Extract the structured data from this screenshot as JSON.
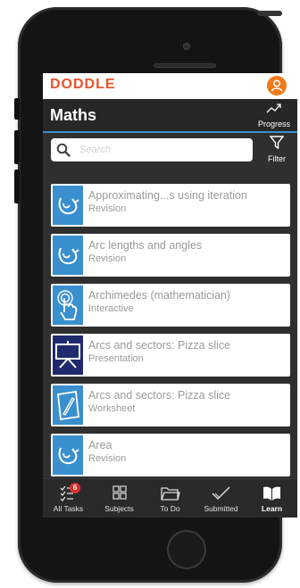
{
  "app": {
    "brand": "DODDLE",
    "subject_title": "Maths"
  },
  "header": {
    "progress_label": "Progress",
    "filter_label": "Filter"
  },
  "search": {
    "placeholder": "Search"
  },
  "list": {
    "items": [
      {
        "title": "Approximating...s using iteration",
        "type": "Revision",
        "icon": "revision-icon",
        "thumb_color": "#3a8fcf"
      },
      {
        "title": "Arc lengths and angles",
        "type": "Revision",
        "icon": "revision-icon",
        "thumb_color": "#3a8fcf"
      },
      {
        "title": "Archimedes (mathematician)",
        "type": "Interactive",
        "icon": "touch-icon",
        "thumb_color": "#3a8fcf"
      },
      {
        "title": "Arcs and sectors: Pizza slice",
        "type": "Presentation",
        "icon": "presentation-icon",
        "thumb_color": "#1f2a6e"
      },
      {
        "title": "Arcs and sectors: Pizza slice",
        "type": "Worksheet",
        "icon": "worksheet-icon",
        "thumb_color": "#3a8fcf"
      },
      {
        "title": "Area",
        "type": "Revision",
        "icon": "revision-icon",
        "thumb_color": "#3a8fcf"
      }
    ]
  },
  "tabs": [
    {
      "label": "All Tasks",
      "icon": "checklist-icon",
      "badge": "6"
    },
    {
      "label": "Subjects",
      "icon": "grid-icon"
    },
    {
      "label": "To Do",
      "icon": "folder-icon"
    },
    {
      "label": "Submitted",
      "icon": "checkmark-icon"
    },
    {
      "label": "Learn",
      "icon": "book-icon",
      "active": true
    }
  ],
  "colors": {
    "accent": "#3d8fd0",
    "brand": "#e8532b",
    "avatar": "#f07a1a",
    "badge": "#e0312b"
  }
}
